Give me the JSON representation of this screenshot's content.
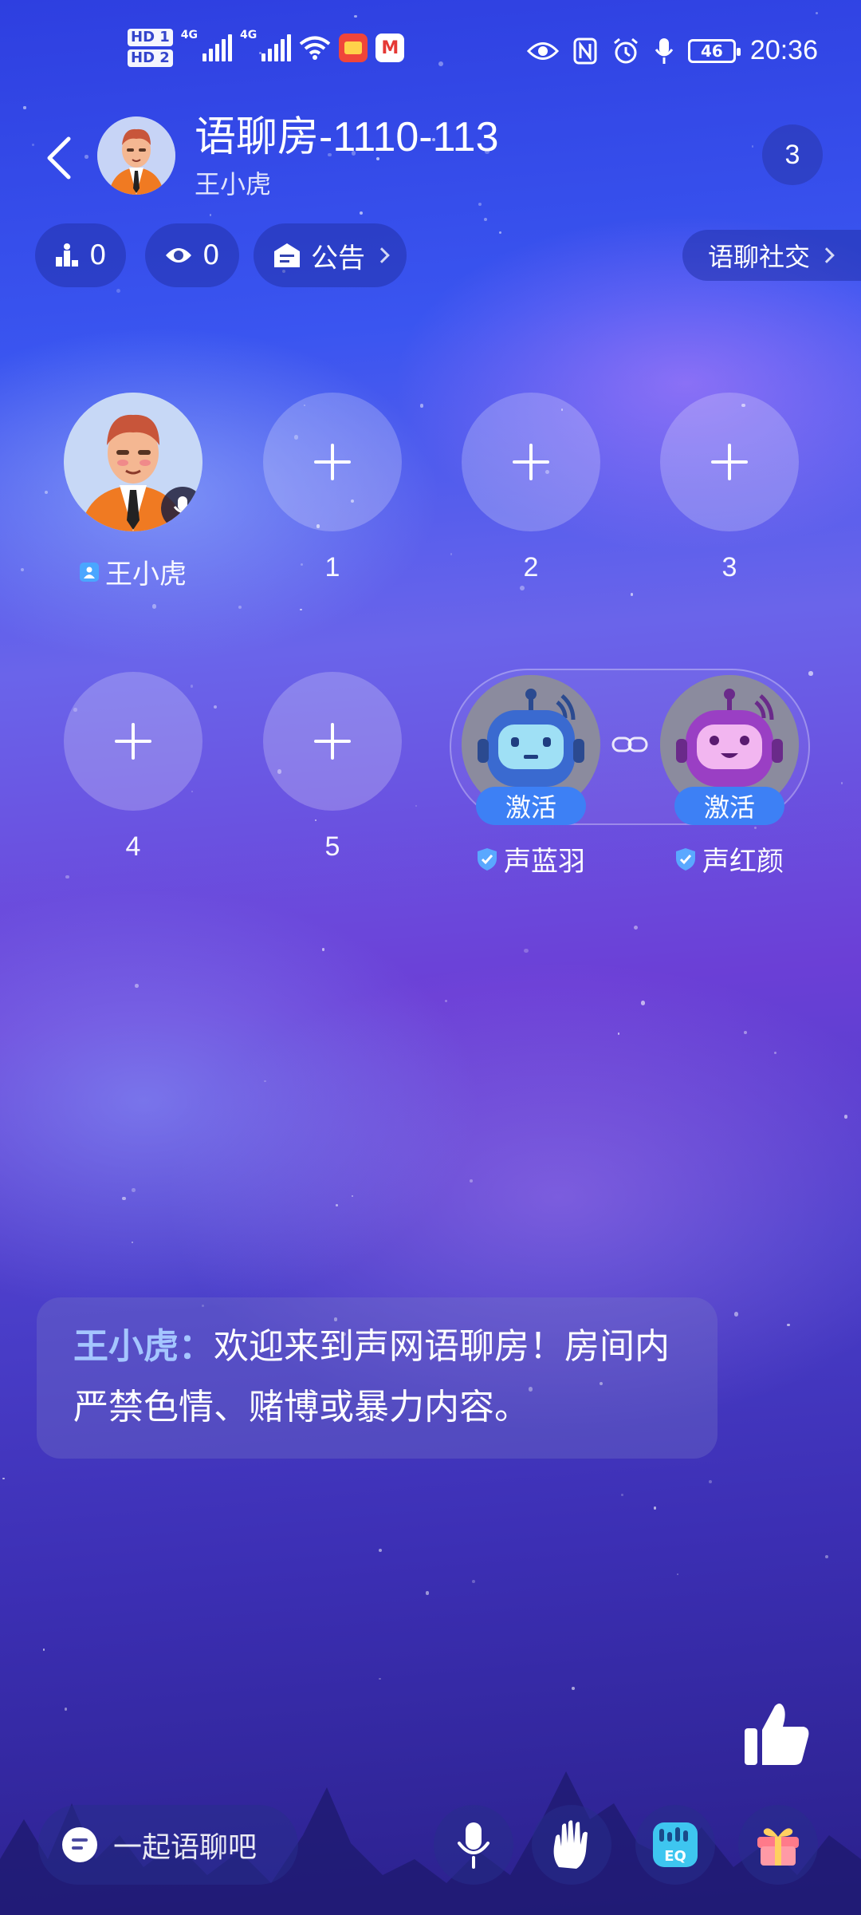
{
  "status_bar": {
    "hd1": "HD 1",
    "hd2": "HD 2",
    "net1": "4G",
    "net2": "4G",
    "battery": "46",
    "time": "20:36"
  },
  "header": {
    "room_title": "语聊房-1110-113",
    "host_name": "王小虎",
    "online_count": "3"
  },
  "pills": {
    "rank_count": "0",
    "view_count": "0",
    "notice_label": "公告",
    "social_label": "语聊社交"
  },
  "seats": [
    {
      "label": "王小虎",
      "type": "host"
    },
    {
      "label": "1"
    },
    {
      "label": "2"
    },
    {
      "label": "3"
    },
    {
      "label": "4"
    },
    {
      "label": "5"
    }
  ],
  "ai_agents": [
    {
      "name": "声蓝羽",
      "button": "激活",
      "color": "#3a6ad0"
    },
    {
      "name": "声红颜",
      "button": "激活",
      "color": "#9a3fc4"
    }
  ],
  "chat": {
    "sender": "王小虎：",
    "message": "欢迎来到声网语聊房！房间内严禁色情、赌博或暴力内容。"
  },
  "bottom_bar": {
    "input_placeholder": "一起语聊吧",
    "icons": [
      "mic-icon",
      "hand-raise-icon",
      "eq-icon",
      "gift-icon"
    ]
  }
}
